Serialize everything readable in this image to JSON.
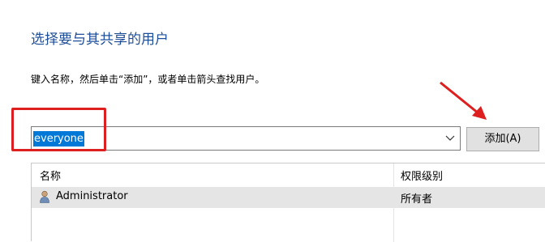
{
  "dialog": {
    "heading": "选择要与其共享的用户",
    "instruction": "键入名称，然后单击“添加”，或者单击箭头查找用户。"
  },
  "combo": {
    "value": "everyone",
    "dropdown_icon": "chevron-down-icon"
  },
  "add_button": {
    "label": "添加(A)"
  },
  "list": {
    "columns": [
      "名称",
      "权限级别"
    ],
    "rows": [
      {
        "icon": "user-icon",
        "name": "Administrator",
        "permission": "所有者"
      }
    ]
  },
  "annotations": {
    "highlight_color": "#dd1f1f",
    "arrow_color": "#dd1f1f"
  },
  "colors": {
    "heading": "#1f4e99",
    "selection": "#0078d7"
  }
}
